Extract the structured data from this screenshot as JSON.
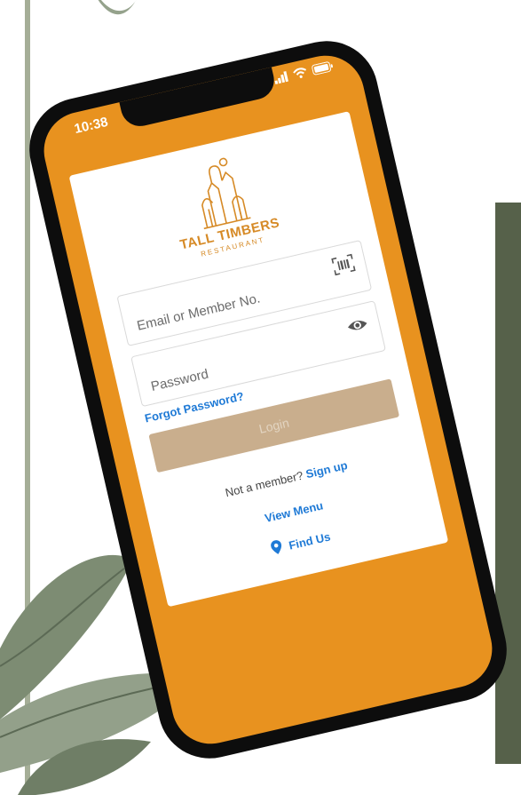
{
  "status_bar": {
    "time": "10:38",
    "icons": [
      "signal-icon",
      "wifi-icon",
      "battery-icon"
    ]
  },
  "brand": {
    "name": "TALL TIMBERS",
    "subtitle": "RESTAURANT",
    "color": "#d68a26"
  },
  "login_form": {
    "email_placeholder": "Email or Member No.",
    "password_placeholder": "Password",
    "forgot_password": "Forgot Password?",
    "login_button": "Login",
    "not_member_text": "Not a member?",
    "signup_link": "Sign up",
    "view_menu": "View Menu",
    "find_us": "Find Us"
  },
  "colors": {
    "screen_background": "#e8921f",
    "link": "#1f7ad6",
    "login_button": "#c9ae8d",
    "side_panel": "#56614a"
  }
}
